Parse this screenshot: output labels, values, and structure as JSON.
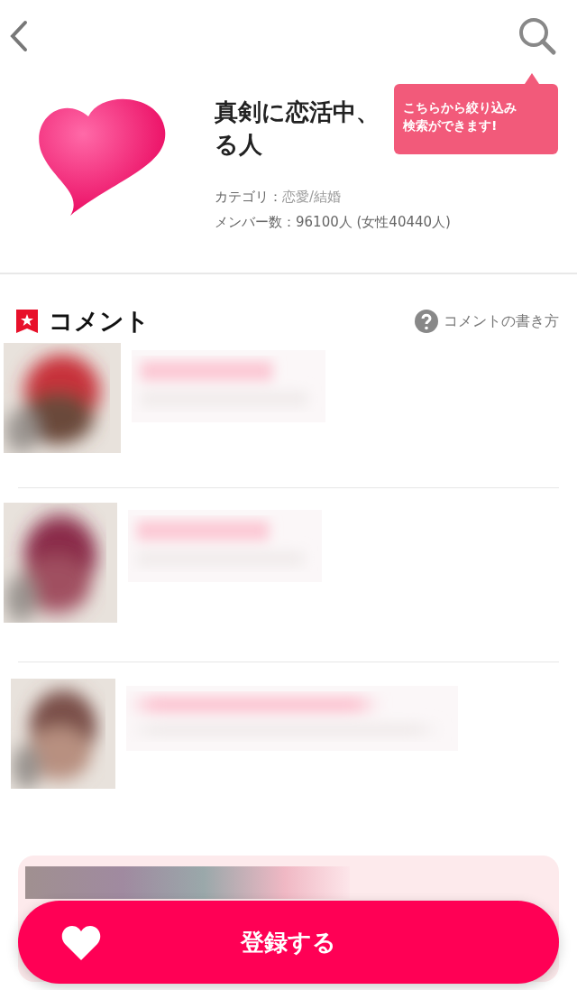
{
  "group": {
    "title_line_1": "真剣に恋活中、",
    "title_line_2": "る人",
    "category_label": "カテゴリ：",
    "category_value": "恋愛/結婚",
    "members_label": "メンバー数：",
    "members_value": "96100人 (女性40440人)"
  },
  "tooltip": {
    "lines": [
      "こちらから絞り込み",
      "検索ができます!"
    ]
  },
  "comments_section": {
    "title": "コメント",
    "help_link": "コメントの書き方"
  },
  "comments": [
    {
      "kind": "blurred"
    },
    {
      "kind": "blurred"
    },
    {
      "kind": "blurred"
    }
  ],
  "register_button": {
    "label": "登録する"
  }
}
